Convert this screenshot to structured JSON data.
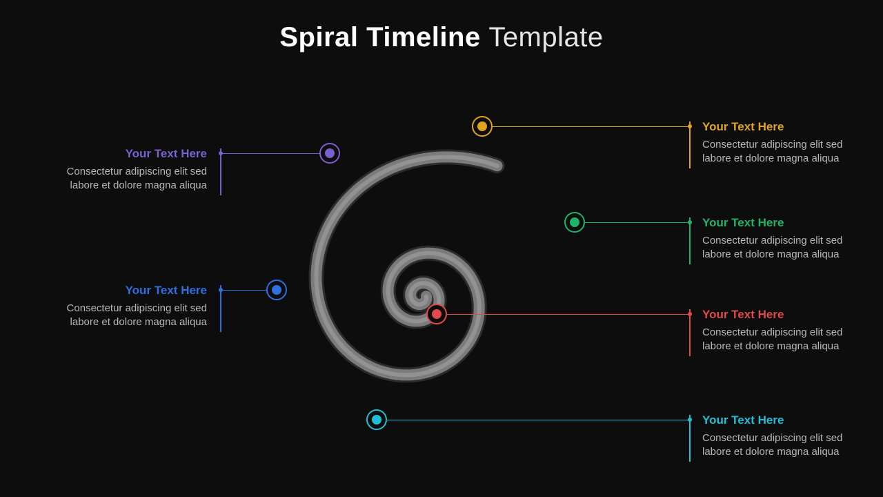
{
  "title": {
    "bold": "Spiral Timeline",
    "thin": "Template"
  },
  "colors": {
    "purple": "#7a5fd0",
    "blue": "#2f6fe0",
    "cyan": "#1ec0d6",
    "red": "#e04a4a",
    "green": "#1fb36a",
    "orange": "#e0a41f"
  },
  "nodes": {
    "purple": {
      "heading": "Your Text Here",
      "body": "Consectetur adipiscing elit sed labore et dolore magna aliqua"
    },
    "blue": {
      "heading": "Your Text Here",
      "body": "Consectetur adipiscing elit sed labore et dolore magna aliqua"
    },
    "cyan": {
      "heading": "Your Text Here",
      "body": "Consectetur adipiscing elit sed labore et dolore magna aliqua"
    },
    "red": {
      "heading": "Your Text Here",
      "body": "Consectetur adipiscing elit sed labore et dolore magna aliqua"
    },
    "green": {
      "heading": "Your Text Here",
      "body": "Consectetur adipiscing elit sed labore et dolore magna aliqua"
    },
    "orange": {
      "heading": "Your Text Here",
      "body": "Consectetur adipiscing elit sed labore et dolore magna aliqua"
    }
  }
}
